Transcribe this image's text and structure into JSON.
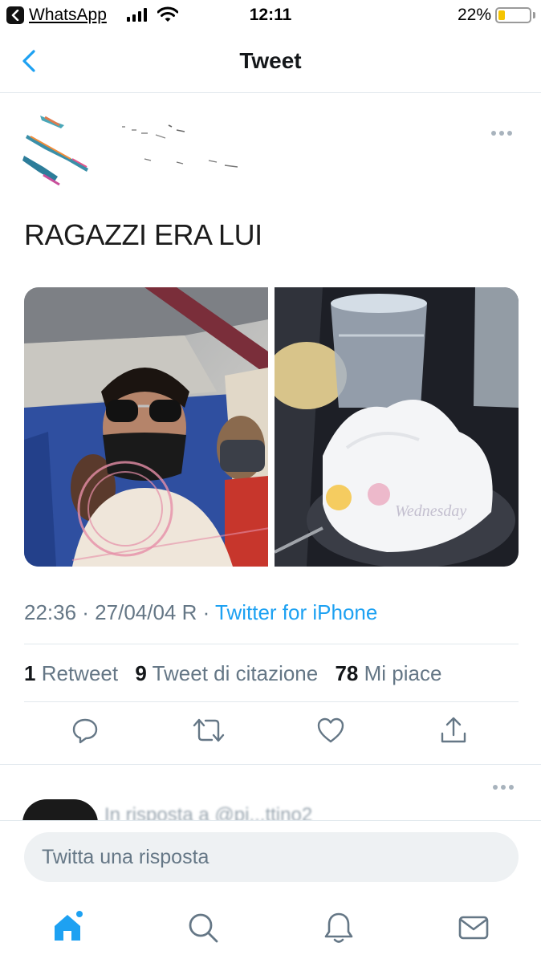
{
  "status_bar": {
    "back_app": "WhatsApp",
    "time": "12:11",
    "battery_percent_label": "22%",
    "battery_level": 0.22,
    "battery_color": "#f5c400"
  },
  "nav": {
    "title": "Tweet",
    "back_icon": "chevron-left-icon",
    "accent_color": "#1da1f2"
  },
  "tweet": {
    "text": "RAGAZZI ERA LUI",
    "media": [
      {
        "icon": "photo-airplane-selfie"
      },
      {
        "icon": "photo-dessert-glasses",
        "watermark": "Wednesday"
      }
    ],
    "timestamp": "22:36 · 27/04/04 R · ",
    "source": "Twitter for iPhone",
    "stats": {
      "retweets_count": "1",
      "retweets_label": "Retweet",
      "quotes_count": "9",
      "quotes_label": "Tweet di citazione",
      "likes_count": "78",
      "likes_label": "Mi piace"
    }
  },
  "reply_preview": {
    "text": "In risposta a @pi...ttino2"
  },
  "compose": {
    "placeholder": "Twitta una risposta"
  },
  "tabs": [
    {
      "icon": "home-icon",
      "active": true
    },
    {
      "icon": "search-icon"
    },
    {
      "icon": "bell-icon"
    },
    {
      "icon": "mail-icon"
    }
  ]
}
